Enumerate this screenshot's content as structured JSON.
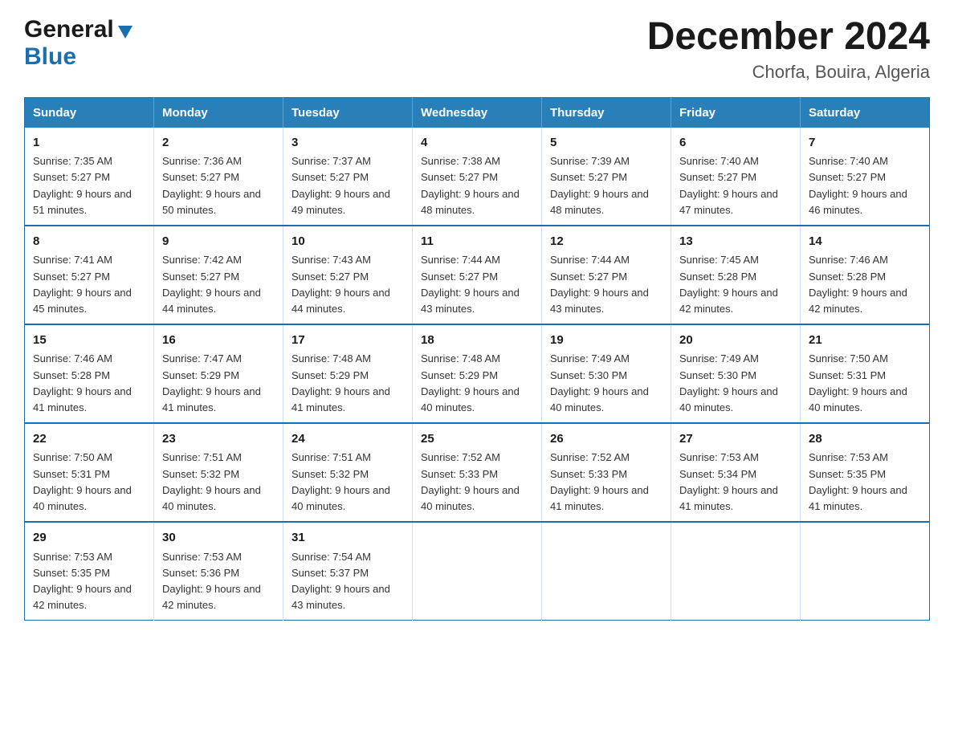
{
  "header": {
    "logo_line1": "General",
    "logo_line2": "Blue",
    "title": "December 2024",
    "subtitle": "Chorfa, Bouira, Algeria"
  },
  "days_of_week": [
    "Sunday",
    "Monday",
    "Tuesday",
    "Wednesday",
    "Thursday",
    "Friday",
    "Saturday"
  ],
  "weeks": [
    [
      {
        "day": "1",
        "sunrise": "7:35 AM",
        "sunset": "5:27 PM",
        "daylight": "9 hours and 51 minutes."
      },
      {
        "day": "2",
        "sunrise": "7:36 AM",
        "sunset": "5:27 PM",
        "daylight": "9 hours and 50 minutes."
      },
      {
        "day": "3",
        "sunrise": "7:37 AM",
        "sunset": "5:27 PM",
        "daylight": "9 hours and 49 minutes."
      },
      {
        "day": "4",
        "sunrise": "7:38 AM",
        "sunset": "5:27 PM",
        "daylight": "9 hours and 48 minutes."
      },
      {
        "day": "5",
        "sunrise": "7:39 AM",
        "sunset": "5:27 PM",
        "daylight": "9 hours and 48 minutes."
      },
      {
        "day": "6",
        "sunrise": "7:40 AM",
        "sunset": "5:27 PM",
        "daylight": "9 hours and 47 minutes."
      },
      {
        "day": "7",
        "sunrise": "7:40 AM",
        "sunset": "5:27 PM",
        "daylight": "9 hours and 46 minutes."
      }
    ],
    [
      {
        "day": "8",
        "sunrise": "7:41 AM",
        "sunset": "5:27 PM",
        "daylight": "9 hours and 45 minutes."
      },
      {
        "day": "9",
        "sunrise": "7:42 AM",
        "sunset": "5:27 PM",
        "daylight": "9 hours and 44 minutes."
      },
      {
        "day": "10",
        "sunrise": "7:43 AM",
        "sunset": "5:27 PM",
        "daylight": "9 hours and 44 minutes."
      },
      {
        "day": "11",
        "sunrise": "7:44 AM",
        "sunset": "5:27 PM",
        "daylight": "9 hours and 43 minutes."
      },
      {
        "day": "12",
        "sunrise": "7:44 AM",
        "sunset": "5:27 PM",
        "daylight": "9 hours and 43 minutes."
      },
      {
        "day": "13",
        "sunrise": "7:45 AM",
        "sunset": "5:28 PM",
        "daylight": "9 hours and 42 minutes."
      },
      {
        "day": "14",
        "sunrise": "7:46 AM",
        "sunset": "5:28 PM",
        "daylight": "9 hours and 42 minutes."
      }
    ],
    [
      {
        "day": "15",
        "sunrise": "7:46 AM",
        "sunset": "5:28 PM",
        "daylight": "9 hours and 41 minutes."
      },
      {
        "day": "16",
        "sunrise": "7:47 AM",
        "sunset": "5:29 PM",
        "daylight": "9 hours and 41 minutes."
      },
      {
        "day": "17",
        "sunrise": "7:48 AM",
        "sunset": "5:29 PM",
        "daylight": "9 hours and 41 minutes."
      },
      {
        "day": "18",
        "sunrise": "7:48 AM",
        "sunset": "5:29 PM",
        "daylight": "9 hours and 40 minutes."
      },
      {
        "day": "19",
        "sunrise": "7:49 AM",
        "sunset": "5:30 PM",
        "daylight": "9 hours and 40 minutes."
      },
      {
        "day": "20",
        "sunrise": "7:49 AM",
        "sunset": "5:30 PM",
        "daylight": "9 hours and 40 minutes."
      },
      {
        "day": "21",
        "sunrise": "7:50 AM",
        "sunset": "5:31 PM",
        "daylight": "9 hours and 40 minutes."
      }
    ],
    [
      {
        "day": "22",
        "sunrise": "7:50 AM",
        "sunset": "5:31 PM",
        "daylight": "9 hours and 40 minutes."
      },
      {
        "day": "23",
        "sunrise": "7:51 AM",
        "sunset": "5:32 PM",
        "daylight": "9 hours and 40 minutes."
      },
      {
        "day": "24",
        "sunrise": "7:51 AM",
        "sunset": "5:32 PM",
        "daylight": "9 hours and 40 minutes."
      },
      {
        "day": "25",
        "sunrise": "7:52 AM",
        "sunset": "5:33 PM",
        "daylight": "9 hours and 40 minutes."
      },
      {
        "day": "26",
        "sunrise": "7:52 AM",
        "sunset": "5:33 PM",
        "daylight": "9 hours and 41 minutes."
      },
      {
        "day": "27",
        "sunrise": "7:53 AM",
        "sunset": "5:34 PM",
        "daylight": "9 hours and 41 minutes."
      },
      {
        "day": "28",
        "sunrise": "7:53 AM",
        "sunset": "5:35 PM",
        "daylight": "9 hours and 41 minutes."
      }
    ],
    [
      {
        "day": "29",
        "sunrise": "7:53 AM",
        "sunset": "5:35 PM",
        "daylight": "9 hours and 42 minutes."
      },
      {
        "day": "30",
        "sunrise": "7:53 AM",
        "sunset": "5:36 PM",
        "daylight": "9 hours and 42 minutes."
      },
      {
        "day": "31",
        "sunrise": "7:54 AM",
        "sunset": "5:37 PM",
        "daylight": "9 hours and 43 minutes."
      },
      null,
      null,
      null,
      null
    ]
  ],
  "labels": {
    "sunrise": "Sunrise:",
    "sunset": "Sunset:",
    "daylight": "Daylight:"
  }
}
